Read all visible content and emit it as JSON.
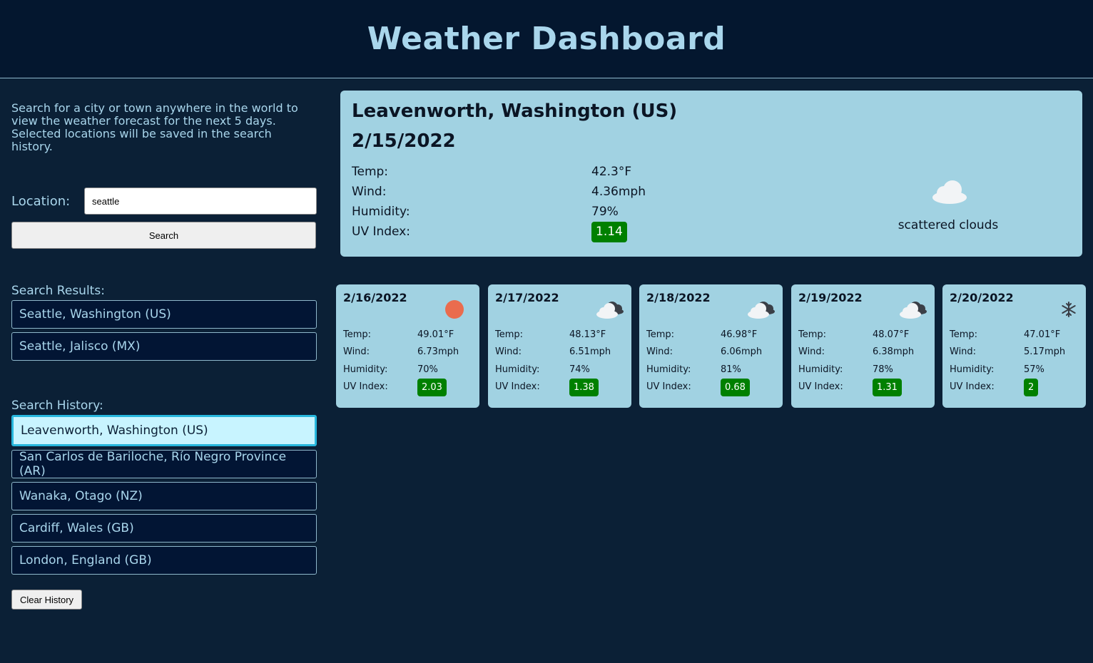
{
  "header": {
    "title": "Weather Dashboard"
  },
  "intro": "Search for a city or town anywhere in the world to view the weather forecast for the next 5 days. Selected locations will be saved in the search history.",
  "search": {
    "label": "Location:",
    "value": "seattle",
    "button_label": "Search"
  },
  "results": {
    "title": "Search Results:",
    "items": [
      "Seattle, Washington (US)",
      "Seattle, Jalisco (MX)"
    ]
  },
  "history": {
    "title": "Search History:",
    "items": [
      "Leavenworth, Washington (US)",
      "San Carlos de Bariloche, Río Negro Province (AR)",
      "Wanaka, Otago (NZ)",
      "Cardiff, Wales (GB)",
      "London, England (GB)"
    ],
    "selected": "Leavenworth, Washington (US)",
    "clear_label": "Clear History"
  },
  "current": {
    "city": "Leavenworth, Washington (US)",
    "date": "2/15/2022",
    "labels": {
      "temp": "Temp:",
      "wind": "Wind:",
      "humidity": "Humidity:",
      "uv": "UV Index:"
    },
    "temp": "42.3°F",
    "wind": "4.36mph",
    "humidity": "79%",
    "uv": "1.14",
    "icon": "cloud-icon",
    "description": "scattered clouds"
  },
  "forecast": [
    {
      "date": "2/16/2022",
      "icon": "sun-icon",
      "temp": "49.01°F",
      "wind": "6.73mph",
      "humidity": "70%",
      "uv": "2.03"
    },
    {
      "date": "2/17/2022",
      "icon": "broken-clouds-icon",
      "temp": "48.13°F",
      "wind": "6.51mph",
      "humidity": "74%",
      "uv": "1.38"
    },
    {
      "date": "2/18/2022",
      "icon": "broken-clouds-icon",
      "temp": "46.98°F",
      "wind": "6.06mph",
      "humidity": "81%",
      "uv": "0.68"
    },
    {
      "date": "2/19/2022",
      "icon": "broken-clouds-icon",
      "temp": "48.07°F",
      "wind": "6.38mph",
      "humidity": "78%",
      "uv": "1.31"
    },
    {
      "date": "2/20/2022",
      "icon": "snow-icon",
      "temp": "47.01°F",
      "wind": "5.17mph",
      "humidity": "57%",
      "uv": "2"
    }
  ],
  "colors": {
    "background": "#0b2036",
    "header": "#04172f",
    "card": "#a1d2e2",
    "accent_text": "#a9d6ec",
    "uv_low": "#008000",
    "sun": "#ea6c4e"
  }
}
